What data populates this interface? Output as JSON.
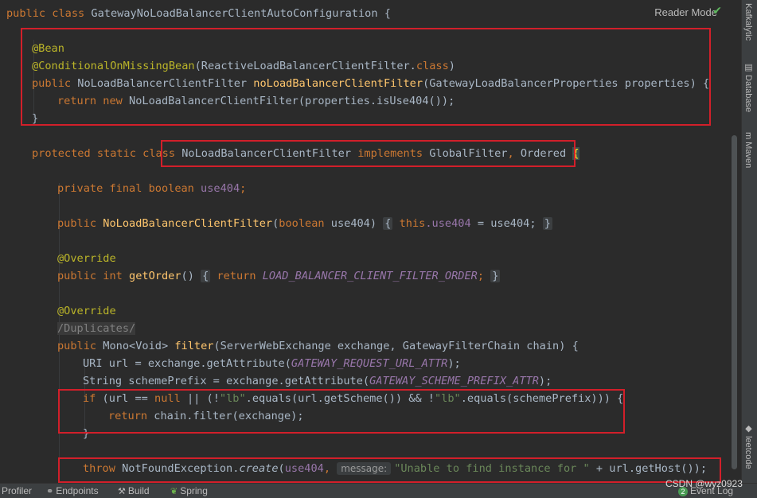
{
  "editor": {
    "reader_mode": "Reader Mode",
    "code": {
      "class_decl": {
        "public": "public",
        "class": "class",
        "name": "GatewayNoLoadBalancerClientAutoConfiguration",
        "brace": " {"
      },
      "bean_ann": "@Bean",
      "cond_ann": "@ConditionalOnMissingBean",
      "cond_args": "(ReactiveLoadBalancerClientFilter.",
      "cond_class_kw": "class",
      "cond_close": ")",
      "m1_public": "public",
      "m1_type": " NoLoadBalancerClientFilter ",
      "m1_name": "noLoadBalancerClientFilter",
      "m1_params": "(GatewayLoadBalancerProperties properties) {",
      "m1_return": "return",
      "m1_new": "new",
      "m1_body": " NoLoadBalancerClientFilter(properties.isUse404());",
      "close_brace": "}",
      "inner_mods": "protected static class",
      "inner_name": " NoLoadBalancerClientFilter ",
      "inner_impl": "implements",
      "inner_ifaces": " GlobalFilter",
      "inner_comma": ",",
      "inner_ordered": " Ordered ",
      "inner_brace": "{",
      "field_mods": "private final boolean",
      "field_name": " use404",
      "semicolon": ";",
      "ctor_public": "public",
      "ctor_name": "NoLoadBalancerClientFilter",
      "ctor_open": "(",
      "ctor_bool": "boolean",
      "ctor_param": " use404)",
      "lbrace": "{",
      "rbrace": "}",
      "ctor_this": "this",
      "ctor_dot_field": ".use404",
      "ctor_assign": " = use404;",
      "override": "@Override",
      "go_mods": "public int",
      "go_name": "getOrder",
      "go_parens": "()",
      "go_return": "return",
      "go_const": "LOAD_BALANCER_CLIENT_FILTER_ORDER",
      "dup_comment": "/Duplicates/",
      "f_public": "public",
      "f_type": " Mono<Void> ",
      "f_name": "filter",
      "f_params": "(ServerWebExchange exchange, GatewayFilterChain chain) {",
      "uri_decl": "URI url = exchange.getAttribute(",
      "uri_const": "GATEWAY_REQUEST_URL_ATTR",
      "close_stmt": ");",
      "sp_decl": "String schemePrefix = exchange.getAttribute(",
      "sp_const": "GATEWAY_SCHEME_PREFIX_ATTR",
      "if_kw": "if",
      "if_a": " (url == ",
      "null_kw": "null",
      "if_b": " || (!",
      "lb_str": "\"lb\"",
      "if_c": ".equals(url.getScheme()) && !",
      "if_d": ".equals(schemePrefix))) {",
      "ret_kw": "return",
      "ret_body": " chain.filter(exchange);",
      "throw_kw": "throw",
      "throw_cls": " NotFoundException.",
      "throw_create": "create",
      "throw_open": "(",
      "throw_field": "use404",
      "throw_comma": ", ",
      "throw_hint": "message:",
      "throw_str": "\"Unable to find instance for \"",
      "throw_rest": " + url.getHost());"
    }
  },
  "right_sidebar": {
    "tabs": [
      "Kafkalytic",
      "Database",
      "Maven",
      "leetcode"
    ]
  },
  "status_bar": {
    "profiler": "Profiler",
    "endpoints": "Endpoints",
    "build": "Build",
    "spring": "Spring",
    "event_log_count": "2",
    "event_log": "Event Log"
  },
  "watermark": "CSDN @wyz0923",
  "colors": {
    "editor_bg": "#2b2b2b",
    "keyword": "#cc7832",
    "annotation": "#bbb529",
    "method_decl": "#ffc66d",
    "field": "#9876aa",
    "string": "#6a8759",
    "plain": "#a9b7c6",
    "highlight_box": "#d21f2a"
  }
}
